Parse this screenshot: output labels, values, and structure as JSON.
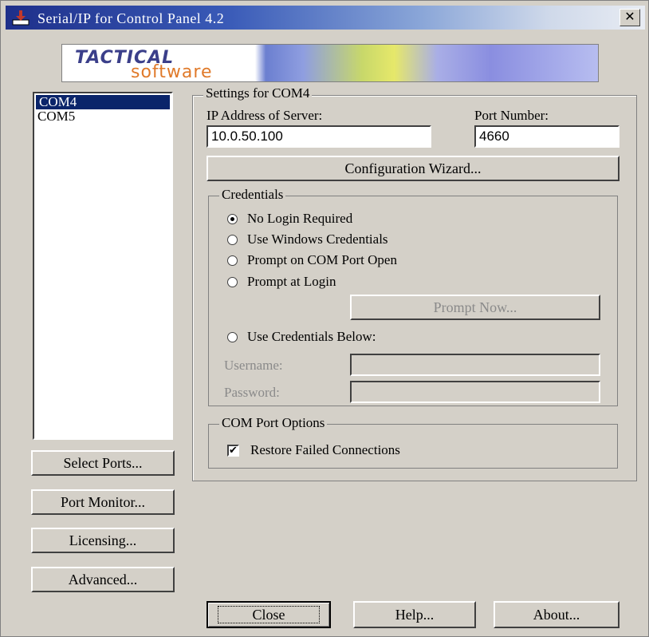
{
  "window": {
    "title": "Serial/IP for Control Panel 4.2",
    "close_glyph": "✕"
  },
  "banner": {
    "line1": "TACTICAL",
    "line2": "software"
  },
  "ports": {
    "items": [
      "COM4",
      "COM5"
    ],
    "selected": "COM4"
  },
  "left_buttons": {
    "select_ports": "Select Ports...",
    "port_monitor": "Port Monitor...",
    "licensing": "Licensing...",
    "advanced": "Advanced..."
  },
  "settings": {
    "legend": "Settings for COM4",
    "ip_label": "IP Address of Server:",
    "ip_value": "10.0.50.100",
    "port_label": "Port Number:",
    "port_value": "4660",
    "wizard_button": "Configuration Wizard..."
  },
  "credentials": {
    "legend": "Credentials",
    "options": [
      {
        "label": "No Login Required",
        "selected": true
      },
      {
        "label": "Use Windows Credentials",
        "selected": false
      },
      {
        "label": "Prompt on COM Port Open",
        "selected": false
      },
      {
        "label": "Prompt at Login",
        "selected": false
      },
      {
        "label": "Use Credentials Below:",
        "selected": false
      }
    ],
    "prompt_now_button": "Prompt Now...",
    "username_label": "Username:",
    "password_label": "Password:"
  },
  "com_port_options": {
    "legend": "COM Port Options",
    "restore_label": "Restore Failed Connections",
    "restore_checked": true,
    "check_glyph": "✔"
  },
  "bottom_buttons": {
    "close": "Close",
    "help": "Help...",
    "about": "About..."
  }
}
